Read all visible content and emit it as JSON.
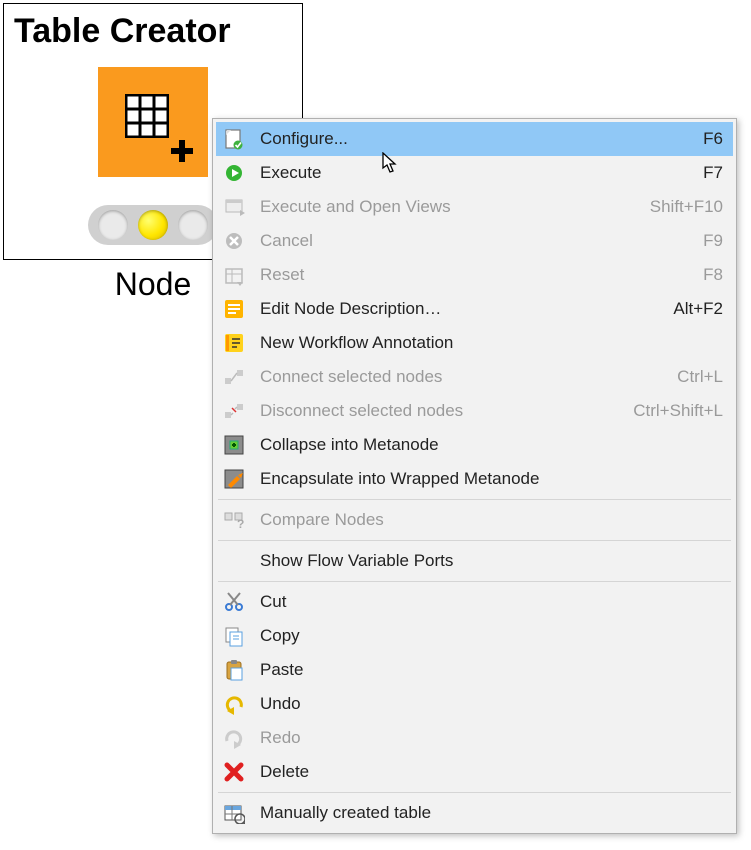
{
  "node": {
    "title": "Table Creator",
    "label": "Node"
  },
  "menu": {
    "items": [
      {
        "icon": "configure",
        "label": "Configure...",
        "shortcut": "F6",
        "enabled": true,
        "highlight": true
      },
      {
        "icon": "execute",
        "label": "Execute",
        "shortcut": "F7",
        "enabled": true
      },
      {
        "icon": "exec-open",
        "label": "Execute and Open Views",
        "shortcut": "Shift+F10",
        "enabled": false
      },
      {
        "icon": "cancel",
        "label": "Cancel",
        "shortcut": "F9",
        "enabled": false
      },
      {
        "icon": "reset",
        "label": "Reset",
        "shortcut": "F8",
        "enabled": false
      },
      {
        "icon": "edit-desc",
        "label": "Edit Node Description…",
        "shortcut": "Alt+F2",
        "enabled": true
      },
      {
        "icon": "annotation",
        "label": "New Workflow Annotation",
        "shortcut": "",
        "enabled": true
      },
      {
        "icon": "connect",
        "label": "Connect selected nodes",
        "shortcut": "Ctrl+L",
        "enabled": false
      },
      {
        "icon": "disconnect",
        "label": "Disconnect selected nodes",
        "shortcut": "Ctrl+Shift+L",
        "enabled": false
      },
      {
        "icon": "collapse",
        "label": "Collapse into Metanode",
        "shortcut": "",
        "enabled": true
      },
      {
        "icon": "encapsulate",
        "label": "Encapsulate into Wrapped Metanode",
        "shortcut": "",
        "enabled": true
      },
      {
        "sep": true
      },
      {
        "icon": "compare",
        "label": "Compare Nodes",
        "shortcut": "",
        "enabled": false
      },
      {
        "sep": true
      },
      {
        "icon": "",
        "label": "Show Flow Variable Ports",
        "shortcut": "",
        "enabled": true
      },
      {
        "sep": true
      },
      {
        "icon": "cut",
        "label": "Cut",
        "shortcut": "",
        "enabled": true
      },
      {
        "icon": "copy",
        "label": "Copy",
        "shortcut": "",
        "enabled": true
      },
      {
        "icon": "paste",
        "label": "Paste",
        "shortcut": "",
        "enabled": true
      },
      {
        "icon": "undo",
        "label": "Undo",
        "shortcut": "",
        "enabled": true
      },
      {
        "icon": "redo",
        "label": "Redo",
        "shortcut": "",
        "enabled": false
      },
      {
        "icon": "delete",
        "label": "Delete",
        "shortcut": "",
        "enabled": true
      },
      {
        "sep": true
      },
      {
        "icon": "table",
        "label": "Manually created table",
        "shortcut": "",
        "enabled": true
      }
    ]
  }
}
